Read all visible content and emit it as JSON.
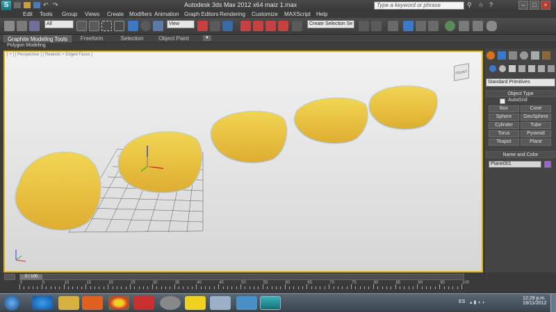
{
  "window": {
    "title": "Autodesk 3ds Max  2012 x64       maiz 1.max",
    "search_placeholder": "Type a keyword or phrase"
  },
  "menu": [
    "Edit",
    "Tools",
    "Group",
    "Views",
    "Create",
    "Modifiers",
    "Animation",
    "Graph Editors",
    "Rendering",
    "Customize",
    "MAXScript",
    "Help"
  ],
  "toolbar": {
    "selection_filter": "All",
    "reference_coord": "View",
    "named_selection": "Create Selection Se"
  },
  "ribbon": {
    "tabs": [
      "Graphite Modeling Tools",
      "Freeform",
      "Selection",
      "Object Paint"
    ],
    "sub_label": "Polygon Modeling"
  },
  "viewport": {
    "label": "[ + ] [ Perspective ] [ Realistic + Edged Faces ]",
    "viewcube_label": "FRONT",
    "object_color": "#f2c020",
    "wire_color": "#a9c6dc"
  },
  "command_panel": {
    "category_dropdown": "Standard Primitives",
    "object_type_header": "Object Type",
    "autogrid_label": "AutoGrid",
    "buttons": [
      [
        "Box",
        "Cone"
      ],
      [
        "Sphere",
        "GeoSphere"
      ],
      [
        "Cylinder",
        "Tube"
      ],
      [
        "Torus",
        "Pyramid"
      ],
      [
        "Teapot",
        "Plane"
      ]
    ],
    "name_color_header": "Name and Color",
    "object_name": "Plane001",
    "object_color_swatch": "#a060d8"
  },
  "timeline": {
    "frame_display": "0 / 100",
    "ticks": [
      "0",
      "5",
      "10",
      "15",
      "20",
      "25",
      "30",
      "35",
      "40",
      "45",
      "50",
      "55",
      "60",
      "65",
      "70",
      "75",
      "80",
      "85",
      "90",
      "95",
      "100"
    ]
  },
  "taskbar": {
    "language": "ES",
    "time": "12:29 p.m.",
    "date": "19/11/2012"
  }
}
